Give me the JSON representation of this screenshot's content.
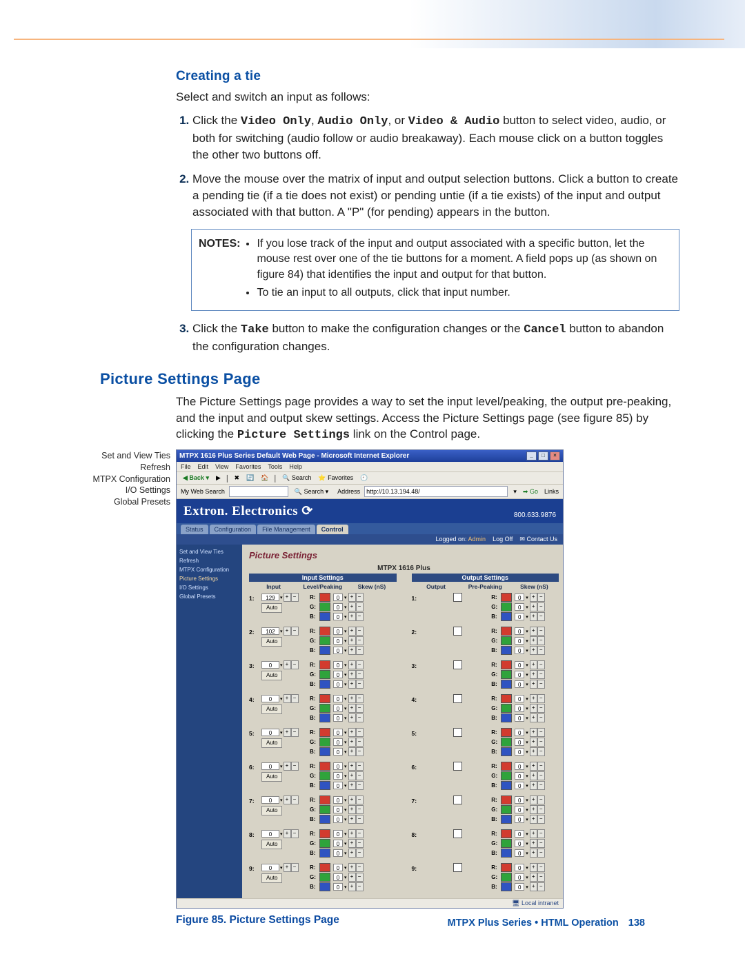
{
  "section1": {
    "heading": "Creating a tie",
    "lead": "Select and switch an input as follows:",
    "step1": {
      "prefix": "Click the ",
      "btn1": "Video Only",
      "sep1": ", ",
      "btn2": "Audio Only",
      "sep2": ", or ",
      "btn3": "Video & Audio",
      "rest": " button to select video, audio, or both for switching (audio follow or audio breakaway). Each mouse click on a button toggles the other two buttons off."
    },
    "step2": "Move the mouse over the matrix of input and output selection buttons. Click a button to create a pending tie (if a tie does not exist) or pending untie (if a tie exists) of the input and output associated with that button. A \"P\" (for pending) appears in the button.",
    "notes_label": "NOTES:",
    "note_bullets": [
      "If you lose track of the input and output associated with a specific button, let the mouse rest over one of the tie buttons for a moment. A field pops up (as shown on figure 84) that identifies the input and output for that button.",
      "To tie an input to all outputs, click that input number."
    ],
    "step3": {
      "prefix": "Click the ",
      "btn1": "Take",
      "mid": " button to make the configuration changes or the ",
      "btn2": "Cancel",
      "rest": " button to abandon the configuration changes."
    }
  },
  "section2": {
    "heading": "Picture Settings Page",
    "para_pre": "The Picture Settings page provides a way to set the input level/peaking, the output pre-peaking, and the input and output skew settings. Access the Picture Settings page (see figure 85) by clicking the ",
    "para_code": "Picture Settings",
    "para_post": " link on the Control page."
  },
  "figure": {
    "title": "MTPX 1616 Plus Series Default Web Page - Microsoft Internet Explorer",
    "menus": [
      "File",
      "Edit",
      "View",
      "Favorites",
      "Tools",
      "Help"
    ],
    "toolbar": {
      "back": "Back",
      "search": "Search",
      "favorites": "Favorites"
    },
    "search_row": {
      "label": "My Web Search",
      "search_btn": "Search",
      "addr_label": "Address",
      "address": "http://10.13.194.48/",
      "go": "Go",
      "links": "Links"
    },
    "brand": "Extron. Electronics",
    "phone": "800.633.9876",
    "tabs": [
      "Status",
      "Configuration",
      "File Management",
      "Control"
    ],
    "logged": "Logged on:",
    "logged_who": "Admin",
    "logoff": "Log Off",
    "contact": "Contact Us",
    "sidebar": [
      "Set and View Ties",
      "Refresh",
      "MTPX Configuration",
      "Picture Settings",
      "I/O Settings",
      "Global Presets"
    ],
    "pane_title": "Picture Settings",
    "model": "MTPX 1616 Plus",
    "input_head": "Input Settings",
    "output_head": "Output Settings",
    "in_cols": [
      "Input",
      "Level/Peaking",
      "Skew (nS)"
    ],
    "out_cols": [
      "Output",
      "Pre-Peaking",
      "Skew (nS)"
    ],
    "rows": [
      {
        "n": "1:",
        "level": "129"
      },
      {
        "n": "2:",
        "level": "102"
      },
      {
        "n": "3:",
        "level": "0"
      },
      {
        "n": "4:",
        "level": "0"
      },
      {
        "n": "5:",
        "level": "0"
      },
      {
        "n": "6:",
        "level": "0"
      },
      {
        "n": "7:",
        "level": "0"
      },
      {
        "n": "8:",
        "level": "0"
      },
      {
        "n": "9:",
        "level": "0"
      }
    ],
    "skew_default": "0",
    "auto_label": "Auto",
    "rgb": [
      "R:",
      "G:",
      "B:"
    ],
    "statusbar": "Local intranet"
  },
  "callouts": {
    "l1": "Set and View Ties",
    "l2": "Refresh",
    "l3": "MTPX Configuration",
    "l4": "I/O Settings",
    "l5": "Global Presets"
  },
  "caption": {
    "label": "Figure 85.",
    "text": " Picture Settings Page"
  },
  "footer": {
    "text": "MTPX Plus Series • HTML Operation",
    "page": "138"
  }
}
